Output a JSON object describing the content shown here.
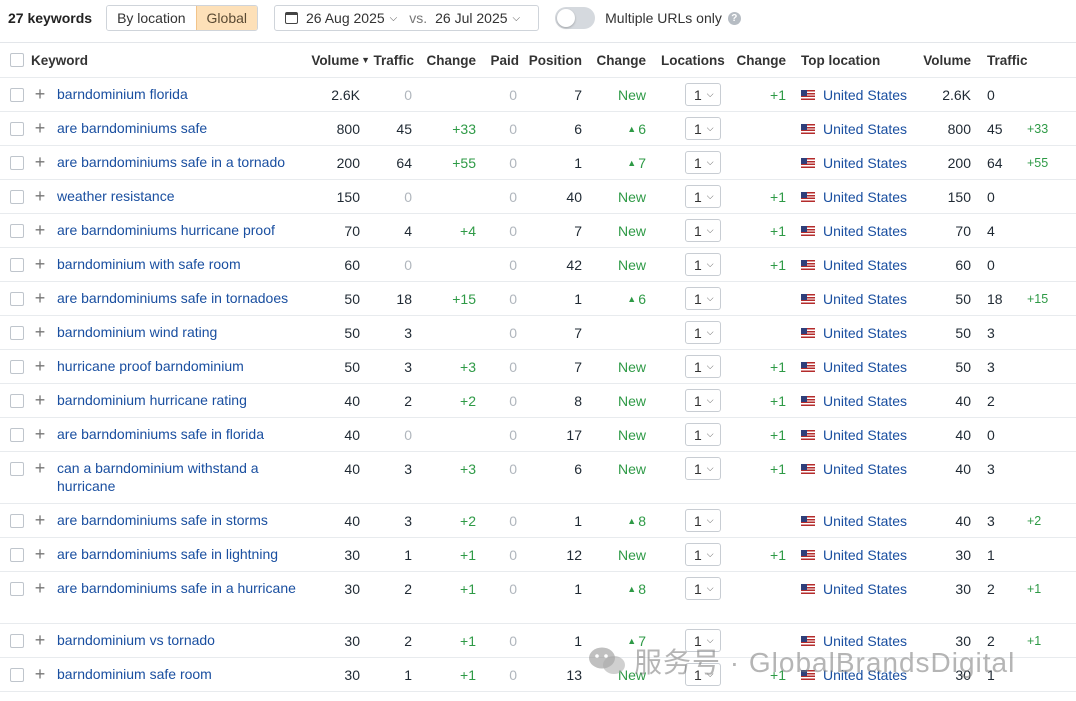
{
  "toolbar": {
    "keyword_count": "27 keywords",
    "by_location": "By location",
    "global": "Global",
    "date_current": "26 Aug 2025",
    "vs": "vs.",
    "date_compare": "26 Jul 2025",
    "multiple_urls": "Multiple URLs only",
    "help": "?"
  },
  "header": {
    "keyword": "Keyword",
    "volume": "Volume",
    "traffic": "Traffic",
    "change": "Change",
    "paid": "Paid",
    "position": "Position",
    "pos_change": "Change",
    "locations": "Locations",
    "loc_change": "Change",
    "top_location": "Top location",
    "tl_volume": "Volume",
    "tl_traffic": "Traffic"
  },
  "rows": [
    {
      "keyword": "barndominium florida",
      "volume": "2.6K",
      "traffic": "0",
      "change": "",
      "paid": "0",
      "position": "7",
      "pos_change": "New",
      "pos_up": false,
      "locations": "1",
      "loc_change": "+1",
      "country": "United States",
      "tl_volume": "2.6K",
      "tl_traffic": "0",
      "tl_change": ""
    },
    {
      "keyword": "are barndominiums safe",
      "volume": "800",
      "traffic": "45",
      "change": "+33",
      "paid": "0",
      "position": "6",
      "pos_change": "6",
      "pos_up": true,
      "locations": "1",
      "loc_change": "",
      "country": "United States",
      "tl_volume": "800",
      "tl_traffic": "45",
      "tl_change": "+33"
    },
    {
      "keyword": "are barndominiums safe in a tornado",
      "volume": "200",
      "traffic": "64",
      "change": "+55",
      "paid": "0",
      "position": "1",
      "pos_change": "7",
      "pos_up": true,
      "locations": "1",
      "loc_change": "",
      "country": "United States",
      "tl_volume": "200",
      "tl_traffic": "64",
      "tl_change": "+55"
    },
    {
      "keyword": "weather resistance",
      "volume": "150",
      "traffic": "0",
      "change": "",
      "paid": "0",
      "position": "40",
      "pos_change": "New",
      "pos_up": false,
      "locations": "1",
      "loc_change": "+1",
      "country": "United States",
      "tl_volume": "150",
      "tl_traffic": "0",
      "tl_change": ""
    },
    {
      "keyword": "are barndominiums hurricane proof",
      "volume": "70",
      "traffic": "4",
      "change": "+4",
      "paid": "0",
      "position": "7",
      "pos_change": "New",
      "pos_up": false,
      "locations": "1",
      "loc_change": "+1",
      "country": "United States",
      "tl_volume": "70",
      "tl_traffic": "4",
      "tl_change": ""
    },
    {
      "keyword": "barndominium with safe room",
      "volume": "60",
      "traffic": "0",
      "change": "",
      "paid": "0",
      "position": "42",
      "pos_change": "New",
      "pos_up": false,
      "locations": "1",
      "loc_change": "+1",
      "country": "United States",
      "tl_volume": "60",
      "tl_traffic": "0",
      "tl_change": ""
    },
    {
      "keyword": "are barndominiums safe in tornadoes",
      "volume": "50",
      "traffic": "18",
      "change": "+15",
      "paid": "0",
      "position": "1",
      "pos_change": "6",
      "pos_up": true,
      "locations": "1",
      "loc_change": "",
      "country": "United States",
      "tl_volume": "50",
      "tl_traffic": "18",
      "tl_change": "+15"
    },
    {
      "keyword": "barndominium wind rating",
      "volume": "50",
      "traffic": "3",
      "change": "",
      "paid": "0",
      "position": "7",
      "pos_change": "",
      "pos_up": false,
      "locations": "1",
      "loc_change": "",
      "country": "United States",
      "tl_volume": "50",
      "tl_traffic": "3",
      "tl_change": ""
    },
    {
      "keyword": "hurricane proof barndominium",
      "volume": "50",
      "traffic": "3",
      "change": "+3",
      "paid": "0",
      "position": "7",
      "pos_change": "New",
      "pos_up": false,
      "locations": "1",
      "loc_change": "+1",
      "country": "United States",
      "tl_volume": "50",
      "tl_traffic": "3",
      "tl_change": ""
    },
    {
      "keyword": "barndominium hurricane rating",
      "volume": "40",
      "traffic": "2",
      "change": "+2",
      "paid": "0",
      "position": "8",
      "pos_change": "New",
      "pos_up": false,
      "locations": "1",
      "loc_change": "+1",
      "country": "United States",
      "tl_volume": "40",
      "tl_traffic": "2",
      "tl_change": ""
    },
    {
      "keyword": "are barndominiums safe in florida",
      "volume": "40",
      "traffic": "0",
      "change": "",
      "paid": "0",
      "position": "17",
      "pos_change": "New",
      "pos_up": false,
      "locations": "1",
      "loc_change": "+1",
      "country": "United States",
      "tl_volume": "40",
      "tl_traffic": "0",
      "tl_change": ""
    },
    {
      "keyword": "can a barndominium withstand a hurricane",
      "volume": "40",
      "traffic": "3",
      "change": "+3",
      "paid": "0",
      "position": "6",
      "pos_change": "New",
      "pos_up": false,
      "locations": "1",
      "loc_change": "+1",
      "country": "United States",
      "tl_volume": "40",
      "tl_traffic": "3",
      "tl_change": ""
    },
    {
      "keyword": "are barndominiums safe in storms",
      "volume": "40",
      "traffic": "3",
      "change": "+2",
      "paid": "0",
      "position": "1",
      "pos_change": "8",
      "pos_up": true,
      "locations": "1",
      "loc_change": "",
      "country": "United States",
      "tl_volume": "40",
      "tl_traffic": "3",
      "tl_change": "+2"
    },
    {
      "keyword": "are barndominiums safe in lightning",
      "volume": "30",
      "traffic": "1",
      "change": "+1",
      "paid": "0",
      "position": "12",
      "pos_change": "New",
      "pos_up": false,
      "locations": "1",
      "loc_change": "+1",
      "country": "United States",
      "tl_volume": "30",
      "tl_traffic": "1",
      "tl_change": ""
    },
    {
      "keyword": "are barndominiums safe in a hurricane",
      "volume": "30",
      "traffic": "2",
      "change": "+1",
      "paid": "0",
      "position": "1",
      "pos_change": "8",
      "pos_up": true,
      "locations": "1",
      "loc_change": "",
      "country": "United States",
      "tl_volume": "30",
      "tl_traffic": "2",
      "tl_change": "+1"
    },
    {
      "keyword": "barndominium vs tornado",
      "volume": "30",
      "traffic": "2",
      "change": "+1",
      "paid": "0",
      "position": "1",
      "pos_change": "7",
      "pos_up": true,
      "locations": "1",
      "loc_change": "",
      "country": "United States",
      "tl_volume": "30",
      "tl_traffic": "2",
      "tl_change": "+1"
    },
    {
      "keyword": "barndominium safe room",
      "volume": "30",
      "traffic": "1",
      "change": "+1",
      "paid": "0",
      "position": "13",
      "pos_change": "New",
      "pos_up": false,
      "locations": "1",
      "loc_change": "+1",
      "country": "United States",
      "tl_volume": "30",
      "tl_traffic": "1",
      "tl_change": ""
    }
  ],
  "watermark": "服务号 · GlobalBrandsDigital"
}
